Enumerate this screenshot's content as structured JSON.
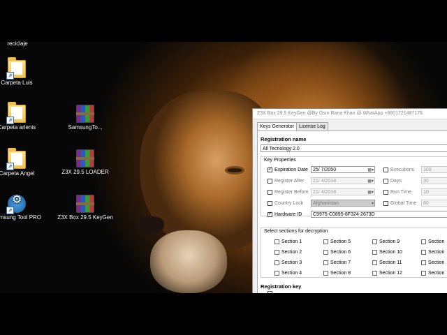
{
  "desktop": {
    "icons": [
      {
        "label": "reciclaje",
        "type": "none"
      },
      {
        "label": "Carpeta Luis",
        "type": "folder"
      },
      {
        "label": "Carpeta arlenis",
        "type": "folder"
      },
      {
        "label": "Carpeta Angel",
        "type": "folder"
      },
      {
        "label": "Samsung Tool PRO",
        "type": "samsung"
      },
      {
        "label": "SamsungTo...",
        "type": "winrar"
      },
      {
        "label": "Z3X 29.5 LOADER",
        "type": "winrar"
      },
      {
        "label": "Z3X Box 29.5 KeyGen",
        "type": "winrar"
      }
    ]
  },
  "keygen": {
    "title": "Z3X Box 29.5 KeyGen @By Gsm Rana Khan @ WhatApp +8801721487176",
    "tabs": [
      "Keys Generator",
      "License Log"
    ],
    "registration_name_label": "Registration name",
    "registration_name": "All Tecnology 2.0",
    "key_properties_label": "Key Properties",
    "expiration_date_label": "Expiration Date",
    "expiration_date": "25/ 7/2050",
    "register_after_label": "Register After",
    "register_after": "21/ 4/2018",
    "register_before_label": "Register Before",
    "register_before": "21/ 4/2018",
    "country_lock_label": "Country Lock",
    "country": "Afghanistan",
    "hardware_id_label": "Hardware ID",
    "hardware_id": "C9975-C0895-8F324-2673D",
    "executions_label": "Executions",
    "executions": "100",
    "days_label": "Days",
    "days": "30",
    "run_time_label": "Run Time",
    "run_time": "10",
    "global_time_label": "Global Time",
    "global_time": "60",
    "sections_label": "Select sections for decryption",
    "sections": [
      [
        "Section 1",
        "Section 5",
        "Section 9",
        "Section"
      ],
      [
        "Section 2",
        "Section 6",
        "Section 10",
        "Section"
      ],
      [
        "Section 3",
        "Section 7",
        "Section 11",
        "Section"
      ],
      [
        "Section 4",
        "Section 8",
        "Section 12",
        "Section"
      ]
    ],
    "registration_key_label": "Registration key",
    "expiration_checked": true,
    "hardware_id_checked": true
  }
}
